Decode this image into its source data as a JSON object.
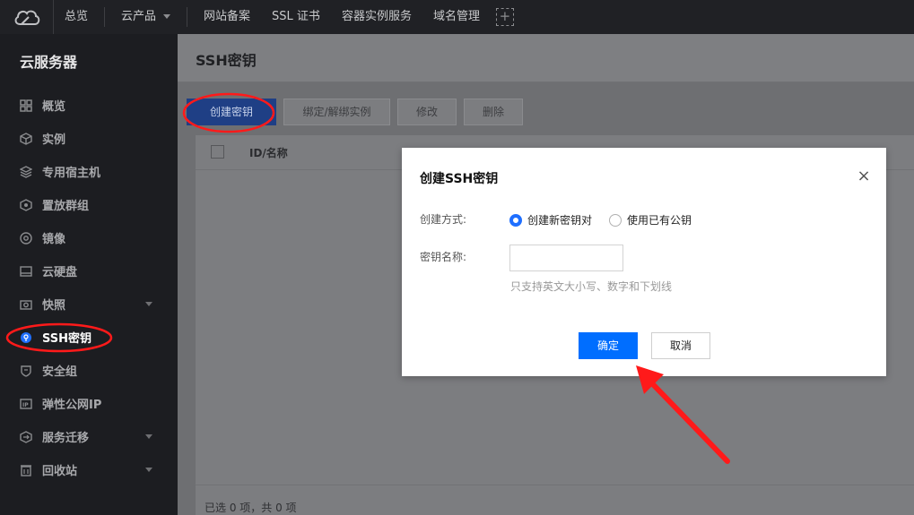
{
  "topnav": {
    "items": [
      "总览",
      "云产品",
      "网站备案",
      "SSL 证书",
      "容器实例服务",
      "域名管理"
    ],
    "plus": "+"
  },
  "sidebar": {
    "title": "云服务器",
    "items": [
      {
        "label": "概览",
        "icon": "grid-icon"
      },
      {
        "label": "实例",
        "icon": "cube-icon"
      },
      {
        "label": "专用宿主机",
        "icon": "layers-icon"
      },
      {
        "label": "置放群组",
        "icon": "hexagon-icon"
      },
      {
        "label": "镜像",
        "icon": "disc-icon"
      },
      {
        "label": "云硬盘",
        "icon": "disk-icon"
      },
      {
        "label": "快照",
        "icon": "camera-icon",
        "expandable": true
      },
      {
        "label": "SSH密钥",
        "icon": "key-icon",
        "active": true
      },
      {
        "label": "安全组",
        "icon": "shield-icon"
      },
      {
        "label": "弹性公网IP",
        "icon": "ip-icon"
      },
      {
        "label": "服务迁移",
        "icon": "migrate-icon",
        "expandable": true
      },
      {
        "label": "回收站",
        "icon": "trash-icon",
        "expandable": true
      }
    ]
  },
  "main": {
    "title": "SSH密钥",
    "toolbar": {
      "create": "创建密钥",
      "bind": "绑定/解绑实例",
      "edit": "修改",
      "delete": "删除"
    },
    "table": {
      "header_id": "ID/名称",
      "footer": "已选 0 项，共 0 项"
    }
  },
  "modal": {
    "title": "创建SSH密钥",
    "close": "×",
    "method_label": "创建方式:",
    "option_new": "创建新密钥对",
    "option_existing": "使用已有公钥",
    "name_label": "密钥名称:",
    "name_value": "",
    "hint": "只支持英文大小写、数字和下划线",
    "ok": "确定",
    "cancel": "取消"
  },
  "colors": {
    "primary": "#006eff",
    "annotation_red": "#ff1a1a"
  }
}
